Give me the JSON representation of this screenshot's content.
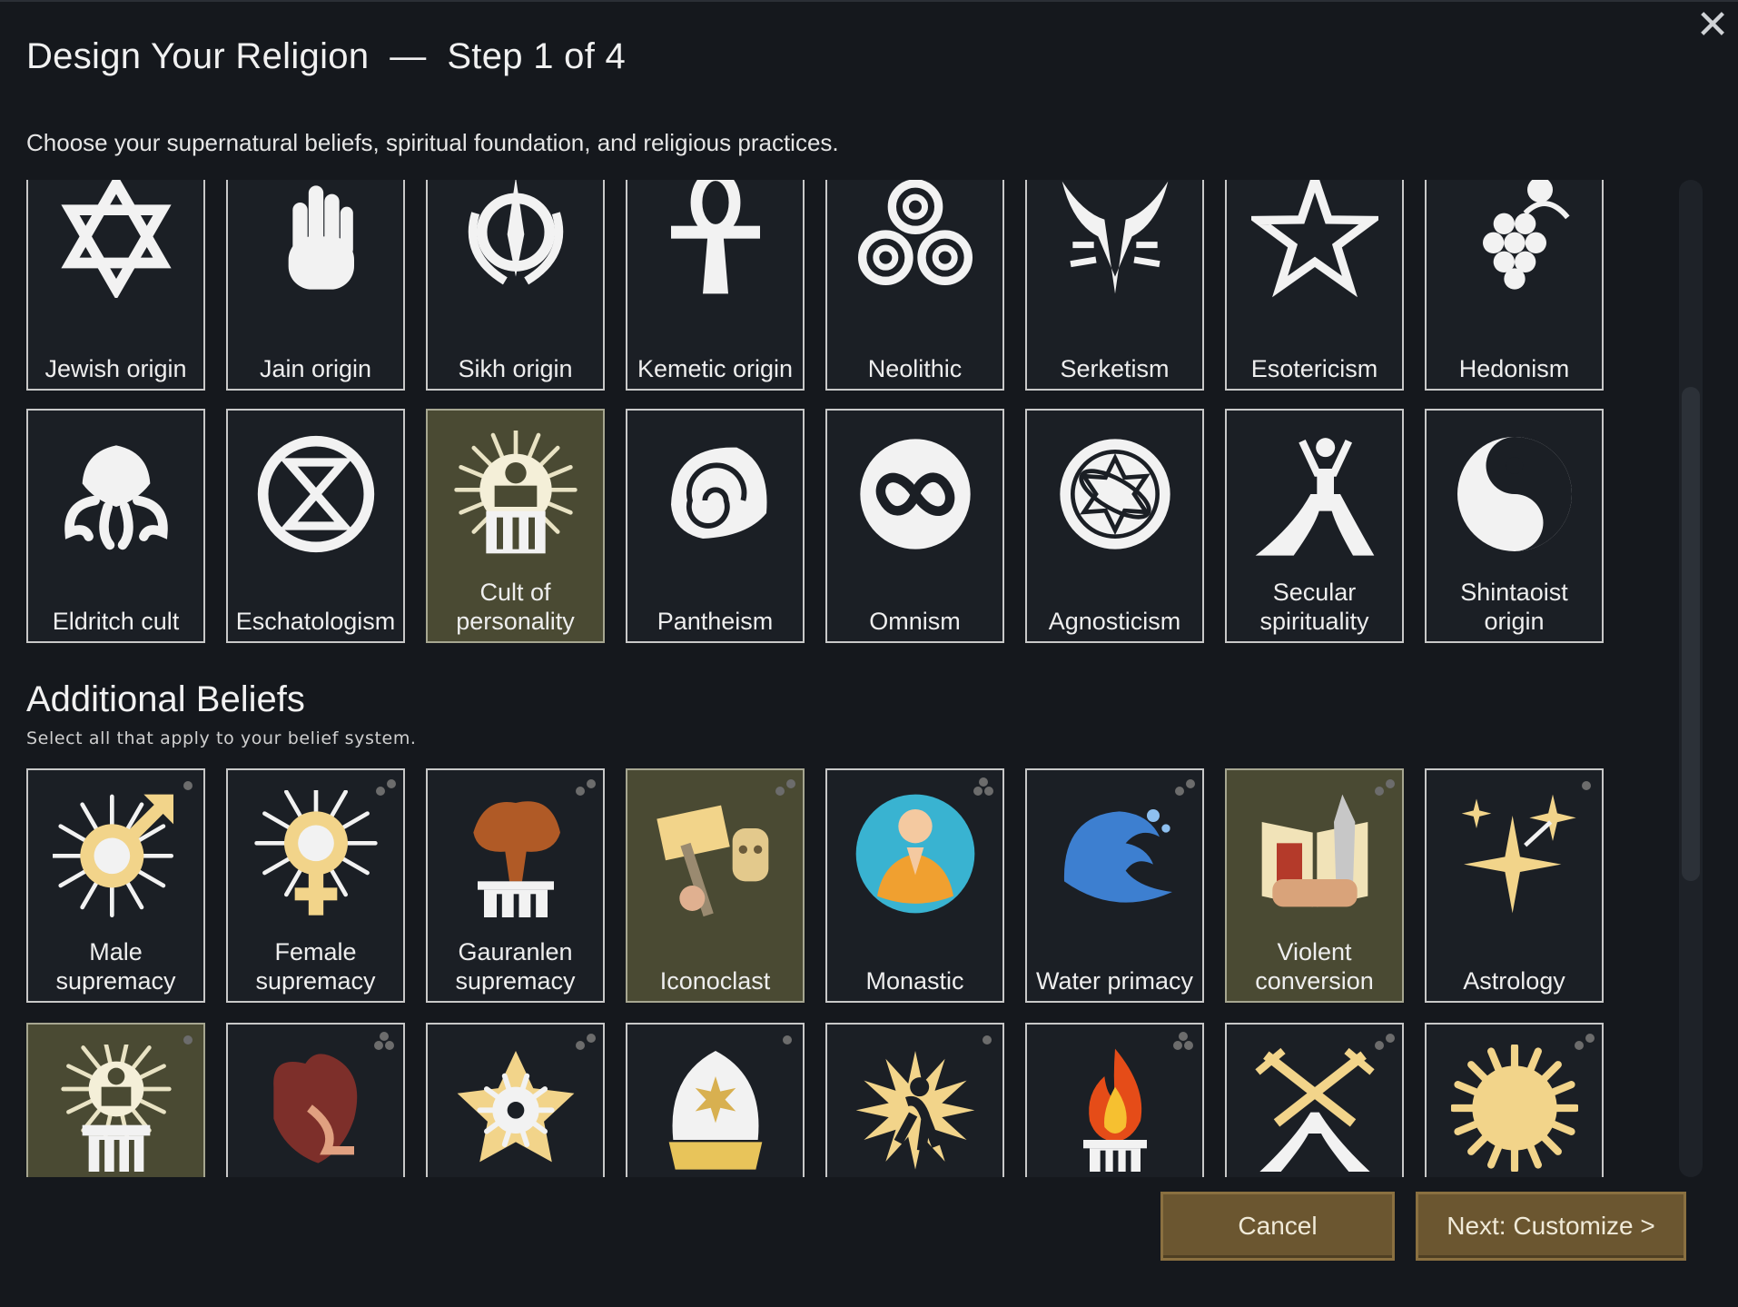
{
  "dialog": {
    "title": "Design Your Religion  —  Step 1 of 4",
    "subtitle": "Choose your supernatural beliefs, spiritual foundation, and religious practices.",
    "close_glyph": "✕"
  },
  "structures": {
    "row1": [
      {
        "label": "Jewish origin",
        "icon": "star-of-david-icon"
      },
      {
        "label": "Jain origin",
        "icon": "raised-hand-icon"
      },
      {
        "label": "Sikh origin",
        "icon": "khanda-icon"
      },
      {
        "label": "Kemetic origin",
        "icon": "ankh-icon"
      },
      {
        "label": "Neolithic",
        "icon": "triskele-icon"
      },
      {
        "label": "Serketism",
        "icon": "scorpion-icon"
      },
      {
        "label": "Esotericism",
        "icon": "pentagram-icon"
      },
      {
        "label": "Hedonism",
        "icon": "grapes-icon"
      }
    ],
    "row2": [
      {
        "label": "Eldritch cult",
        "icon": "tentacles-icon"
      },
      {
        "label": "Eschatologism",
        "icon": "hourglass-circle-icon"
      },
      {
        "label": "Cult of personality",
        "icon": "throne-figure-icon",
        "selected": true
      },
      {
        "label": "Pantheism",
        "icon": "nautilus-shell-icon"
      },
      {
        "label": "Omnism",
        "icon": "infinity-circle-icon"
      },
      {
        "label": "Agnosticism",
        "icon": "atom-circle-icon"
      },
      {
        "label": "Secular spirituality",
        "icon": "figure-on-peak-icon"
      },
      {
        "label": "Shintaoist origin",
        "icon": "yin-yang-icon"
      }
    ]
  },
  "additional": {
    "title": "Additional Beliefs",
    "subtitle": "Select all that apply to your belief system.",
    "row1": [
      {
        "label": "Male supremacy",
        "icon": "male-symbol-icon",
        "dots": 1
      },
      {
        "label": "Female supremacy",
        "icon": "female-symbol-icon",
        "dots": 2
      },
      {
        "label": "Gauranlen supremacy",
        "icon": "tree-pillar-icon",
        "dots": 2
      },
      {
        "label": "Iconoclast",
        "icon": "hammer-idol-icon",
        "dots": 2,
        "selected": true
      },
      {
        "label": "Monastic",
        "icon": "meditating-monk-icon",
        "dots": 3
      },
      {
        "label": "Water primacy",
        "icon": "wave-icon",
        "dots": 2
      },
      {
        "label": "Violent conversion",
        "icon": "book-dagger-icon",
        "dots": 2,
        "selected": true
      },
      {
        "label": "Astrology",
        "icon": "sparkle-stars-icon",
        "dots": 1
      }
    ],
    "row2": [
      {
        "icon": "throne-pillar-icon",
        "dots": 1,
        "selected": true
      },
      {
        "icon": "heart-organ-icon",
        "dots": 3
      },
      {
        "icon": "virus-star-icon",
        "dots": 2
      },
      {
        "icon": "mitre-icon",
        "dots": 1
      },
      {
        "icon": "elder-burst-icon",
        "dots": 1
      },
      {
        "icon": "flame-pillar-icon",
        "dots": 3
      },
      {
        "icon": "crossed-swords-icon",
        "dots": 2
      },
      {
        "icon": "sun-icon",
        "dots": 2
      }
    ]
  },
  "buttons": {
    "cancel": "Cancel",
    "next": "Next: Customize >"
  },
  "colors": {
    "background": "#15181d",
    "tile": "#1b1f25",
    "tile_selected": "#4a4a33",
    "button": "#6b5630",
    "icon_gold": "#f2d48a"
  }
}
